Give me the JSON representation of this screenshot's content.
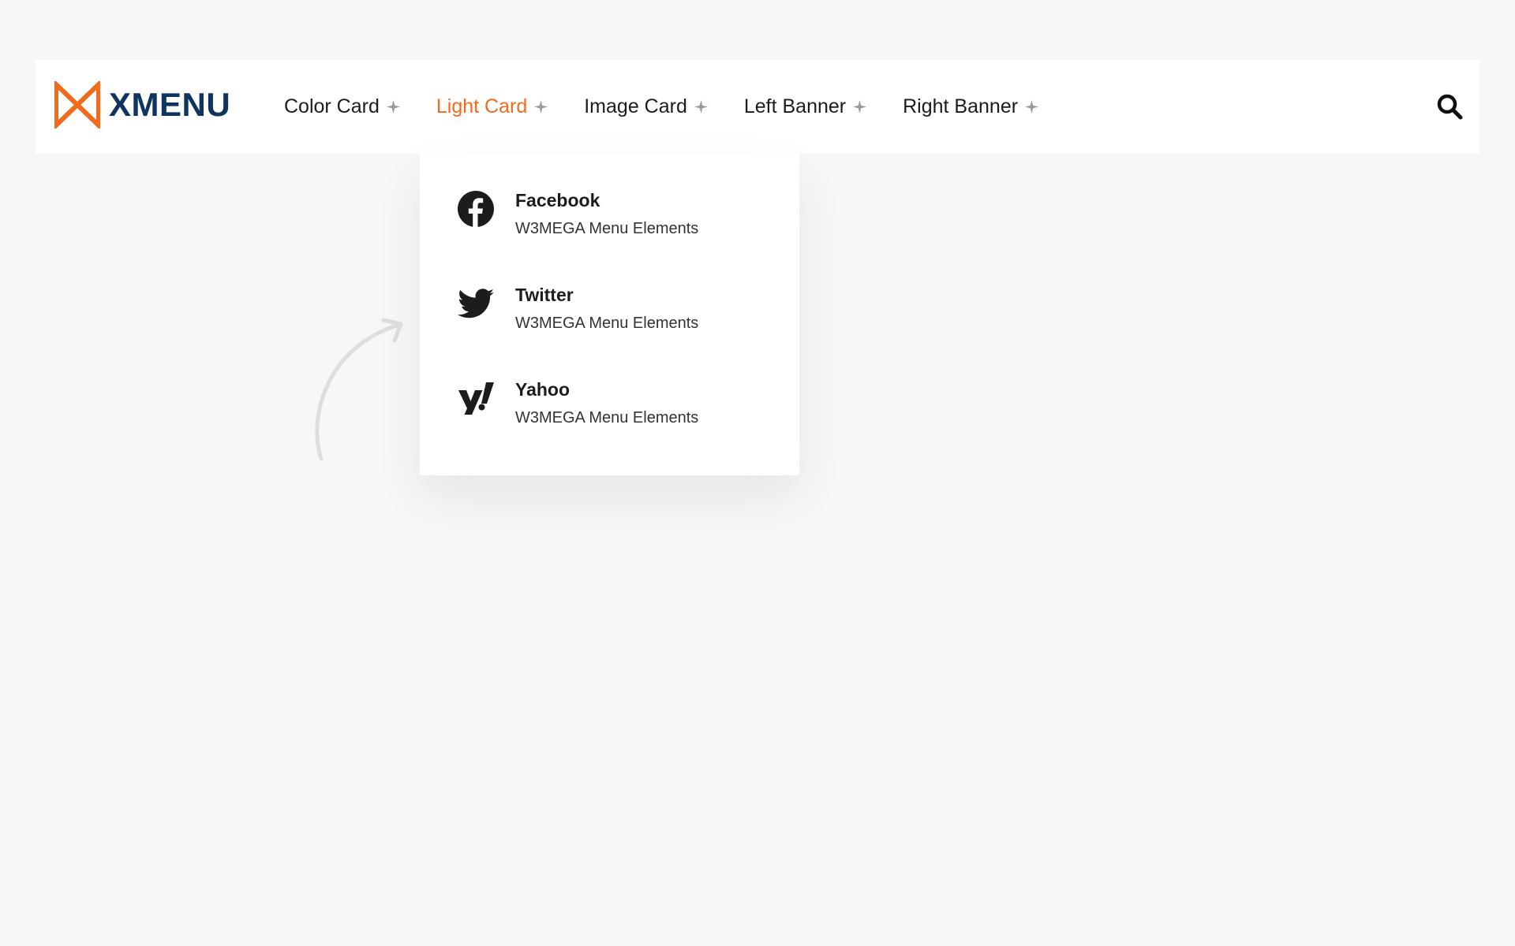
{
  "brand": {
    "name": "XMENU",
    "logo_icon": "bowtie-logo-icon",
    "accent": "#f26a1b",
    "brand_color": "#0f3460"
  },
  "nav": {
    "items": [
      {
        "label": "Color Card",
        "active": false
      },
      {
        "label": "Light Card",
        "active": true
      },
      {
        "label": "Image Card",
        "active": false
      },
      {
        "label": "Left Banner",
        "active": false
      },
      {
        "label": "Right Banner",
        "active": false
      }
    ],
    "search_icon": "search-icon"
  },
  "dropdown": {
    "items": [
      {
        "title": "Facebook",
        "subtitle": "W3MEGA Menu Elements",
        "icon": "facebook-icon"
      },
      {
        "title": "Twitter",
        "subtitle": "W3MEGA Menu Elements",
        "icon": "twitter-icon"
      },
      {
        "title": "Yahoo",
        "subtitle": "W3MEGA Menu Elements",
        "icon": "yahoo-icon"
      }
    ]
  }
}
